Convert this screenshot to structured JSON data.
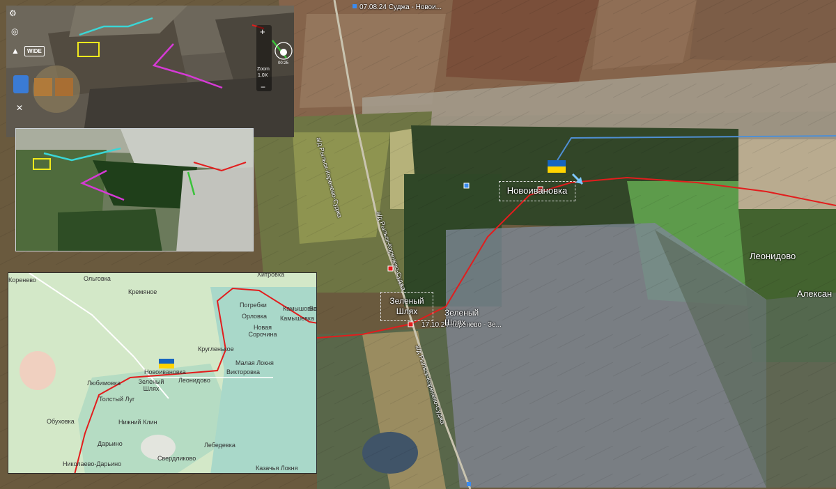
{
  "main_map": {
    "header_caption": "07.08.24 Суджа - Новои...",
    "bottom_caption": "17.10.24 Коренево - Зе...",
    "road_label_upper": "а/д Рыльск-Коренево-Суджа",
    "road_label_middle": "а/д Рыльск-Коренево-Суджа",
    "road_label_lower": "а/д Рыльск-Коренево-Суджа",
    "village_novoivanovka": "Новоивановка",
    "village_zeleny_boxed": "Зеленый Шлях",
    "village_zeleny_plain": "Зеленый Шлях",
    "village_leonidovo": "Леонидово",
    "village_aleksandrovka": "Алексан"
  },
  "drone_panel": {
    "wide_label": "WIDE",
    "zoom_label": "Zoom",
    "zoom_value": "1.0X",
    "zoom_plus": "+",
    "zoom_minus": "−",
    "timer_value": "00:25"
  },
  "mini_map": {
    "labels": [
      "Коренево",
      "Ольговка",
      "Кремяное",
      "Хитровка",
      "Погребки",
      "Камышовка",
      "Орловка",
      "Новая Сорочина",
      "Кругленькое",
      "Малая Локня",
      "Викторовка",
      "Новоивановка",
      "Любимовка",
      "Зеленый Шлях",
      "Леонидово",
      "Толстый Луг",
      "Нижний Клин",
      "Обуховка",
      "Дарьино",
      "Лебедевка",
      "Николаево-Дарьино",
      "Свердликово",
      "Казачья Локня"
    ],
    "village_kamyshevka_tail": "Вои..."
  },
  "colors": {
    "front_line": "#e21d1d",
    "flag_blue": "#1565c0",
    "flag_yellow": "#ffd400",
    "cyan_route": "#3ad6d6",
    "magenta_route": "#d63ad6",
    "target_box": "#f2ea1c"
  },
  "icons": [
    "ukraine-flag-icon",
    "drone-arrow-icon",
    "position-marker-icon",
    "gear-icon",
    "compass-icon"
  ]
}
